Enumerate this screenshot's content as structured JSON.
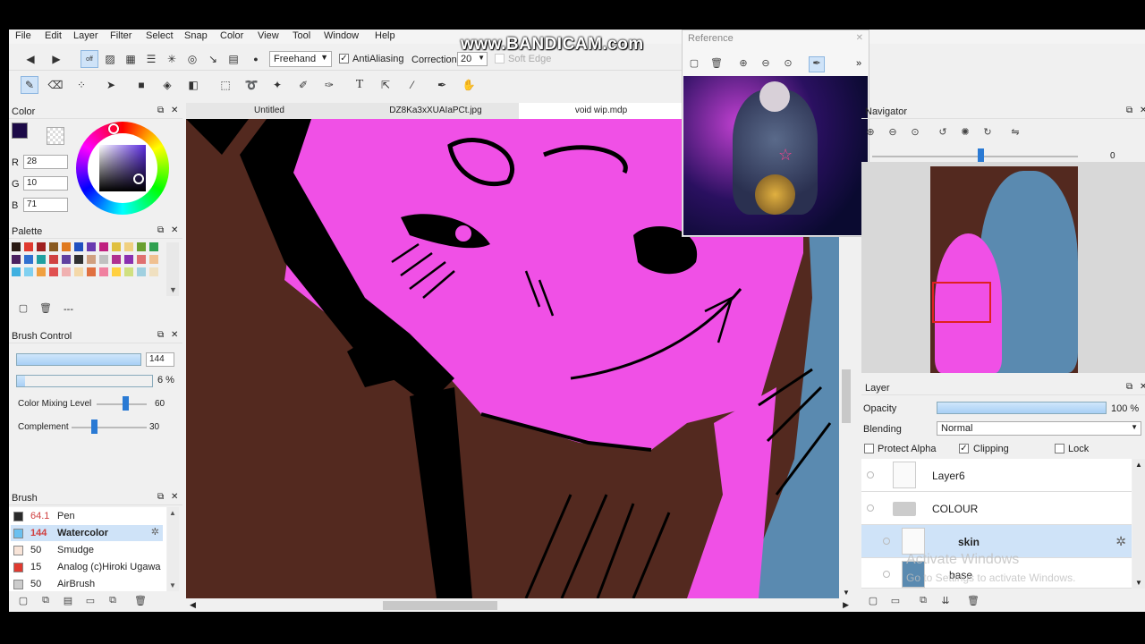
{
  "watermark": "www.BANDICAM.com",
  "menu": [
    "File",
    "Edit",
    "Layer",
    "Filter",
    "Select",
    "Snap",
    "Color",
    "View",
    "Tool",
    "Window",
    "Help"
  ],
  "toolbar": {
    "off_label": "off",
    "mode_value": "Freehand",
    "antialiasing_label": "AntiAliasing",
    "correction_label": "Correction",
    "correction_value": "20",
    "soft_edge_label": "Soft Edge"
  },
  "color_panel": {
    "title": "Color",
    "r_label": "R",
    "r_value": "28",
    "g_label": "G",
    "g_value": "10",
    "b_label": "B",
    "b_value": "71",
    "current_color": "#1c0a47"
  },
  "palette_panel": {
    "title": "Palette",
    "more_label": "---",
    "colors": [
      "#2a1a14",
      "#e03a30",
      "#a02020",
      "#8a5a20",
      "#e07a20",
      "#2050c0",
      "#6a3ab0",
      "#c02080",
      "#e0c040",
      "#f0d080",
      "#6aa030",
      "#30a050",
      "#4a2060",
      "#3070d0",
      "#20a0a0",
      "#d04040",
      "#6040a0",
      "#303030",
      "#d0a080",
      "#c0c0c0",
      "#b03090",
      "#8a30b0",
      "#e07070",
      "#f0c090",
      "#40b0e0",
      "#80d0f0",
      "#f0a040",
      "#e05050",
      "#f0b0b0",
      "#f4d8a8",
      "#e07040",
      "#f080a0",
      "#ffd040",
      "#d0e080",
      "#a0d0e0",
      "#f0e0c0"
    ]
  },
  "brush_control": {
    "title": "Brush Control",
    "size_value": "144",
    "min_size_value": "6 %",
    "mixing_label": "Color Mixing Level",
    "mixing_value": "60",
    "mixing_level": 60,
    "complement_label": "Complement",
    "complement_value": "30",
    "complement_level": 30
  },
  "brush_panel": {
    "title": "Brush",
    "items": [
      {
        "size": "64.1",
        "name": "Pen",
        "color": "#2a2a2a",
        "size_color": "#d04040"
      },
      {
        "size": "144",
        "name": "Watercolor",
        "color": "#6ac0f0",
        "size_color": "#d04040"
      },
      {
        "size": "50",
        "name": "Smudge",
        "color": "#f8e4d8",
        "size_color": "#222"
      },
      {
        "size": "15",
        "name": "Analog (c)Hiroki Ugawa",
        "color": "#e03a30",
        "size_color": "#222"
      },
      {
        "size": "50",
        "name": "AirBrush",
        "color": "#cccccc",
        "size_color": "#222"
      }
    ]
  },
  "tabs": [
    "Untitled",
    "DZ8Ka3xXUAIaPCt.jpg",
    "void wip.mdp"
  ],
  "reference": {
    "title": "Reference"
  },
  "navigator": {
    "title": "Navigator",
    "rotation": "0 Degree"
  },
  "layer_panel": {
    "title": "Layer",
    "opacity_label": "Opacity",
    "opacity_value": "100 %",
    "blending_label": "Blending",
    "blending_value": "Normal",
    "protect_alpha_label": "Protect Alpha",
    "clipping_label": "Clipping",
    "lock_label": "Lock",
    "layers": [
      "Layer6",
      "COLOUR",
      "skin",
      "base"
    ]
  },
  "overlay": {
    "activate_title": "Activate Windows",
    "activate_sub": "Go to Settings to activate Windows."
  },
  "colors": {
    "canvas_bg": "#53291f",
    "skin_pink": "#f050e6",
    "hair_blue": "#5a8ab0",
    "selection": "#cfe3f8"
  }
}
